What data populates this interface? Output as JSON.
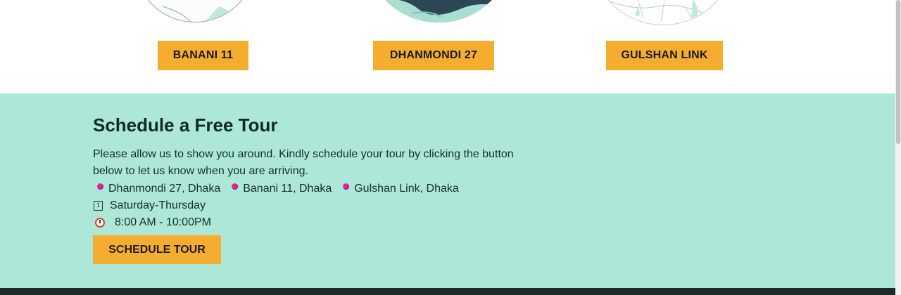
{
  "branches": {
    "buttons": [
      {
        "label": "BANANI 11"
      },
      {
        "label": "DHANMONDI 27"
      },
      {
        "label": "GULSHAN LINK"
      }
    ]
  },
  "tour": {
    "title": "Schedule a Free Tour",
    "description": "Please allow us to show you around. Kindly schedule your tour by clicking the button below to let us know when you are arriving.",
    "locations": [
      {
        "label": "Dhanmondi 27, Dhaka"
      },
      {
        "label": "Banani 11, Dhaka"
      },
      {
        "label": "Gulshan Link, Dhaka"
      }
    ],
    "days": "Saturday-Thursday",
    "hours": "8:00 AM - 10:00PM",
    "button_label": "SCHEDULE TOUR",
    "icons": {
      "location": "pin-icon",
      "days": "calendar-icon",
      "hours": "clock-icon"
    }
  },
  "colors": {
    "accent": "#f5ad2f",
    "section_bg": "#ade7d7",
    "pin": "#e0249a"
  }
}
